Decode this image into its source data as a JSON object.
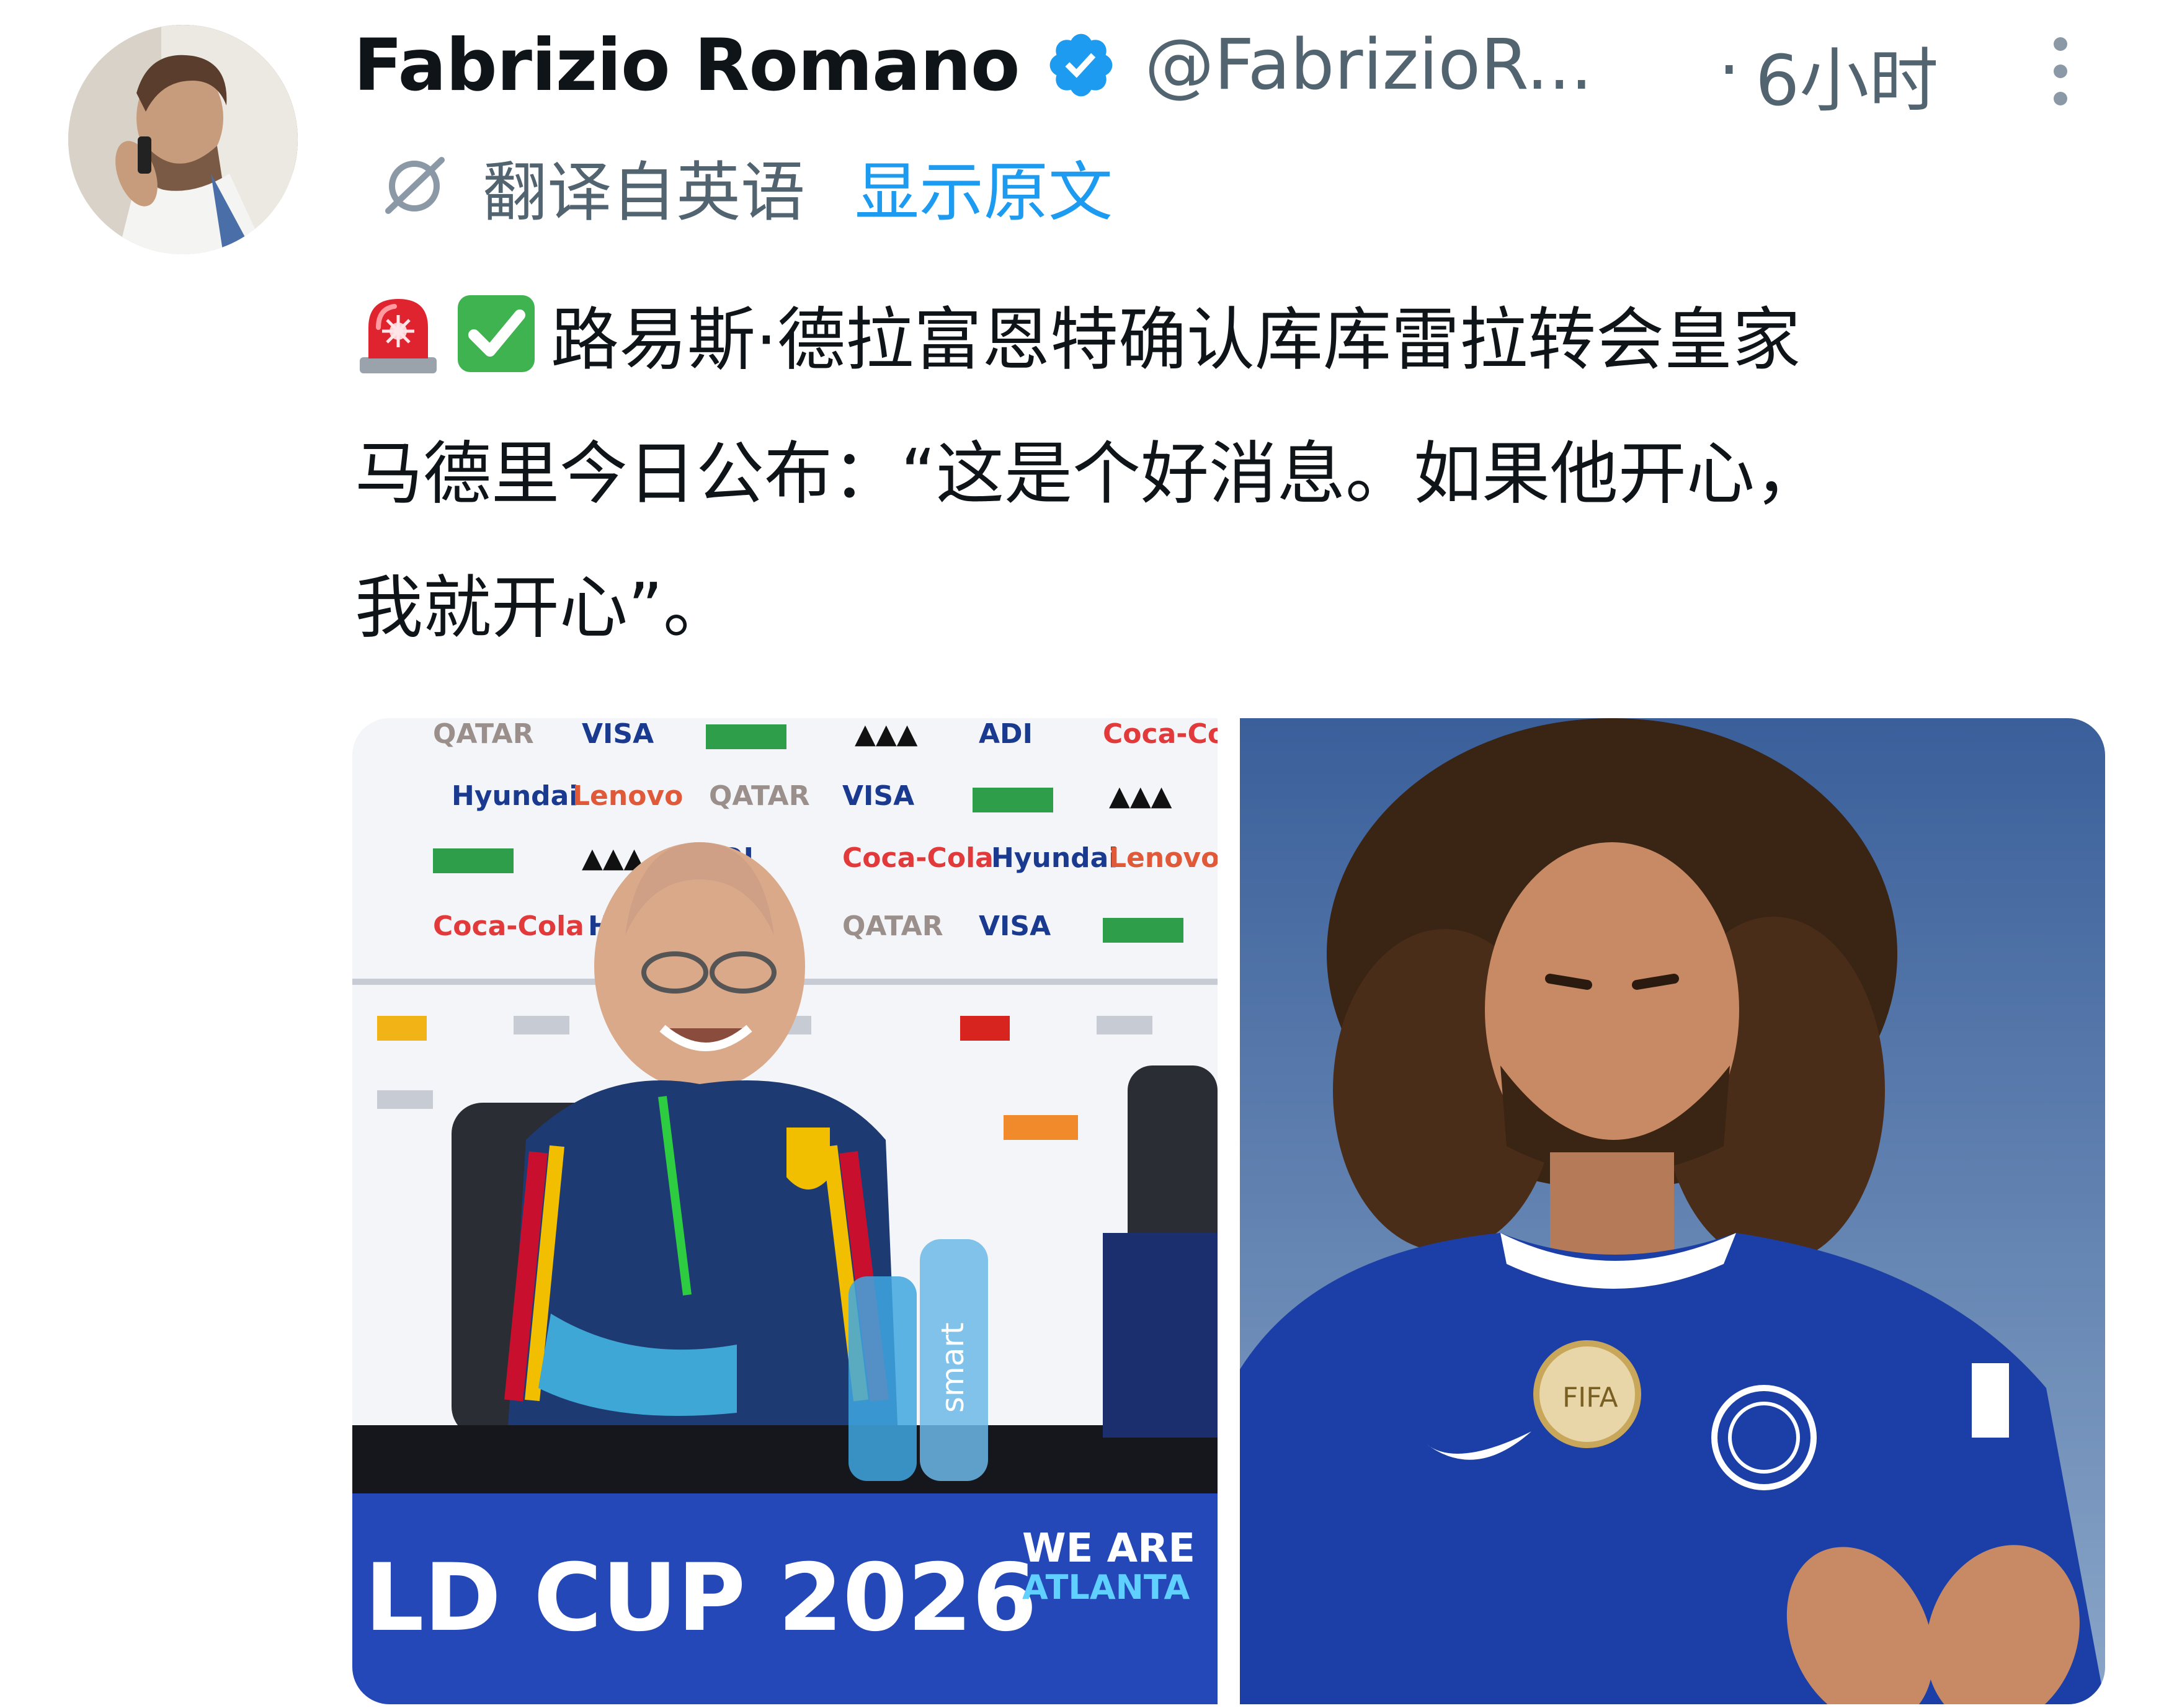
{
  "author": {
    "display_name": "Fabrizio Romano",
    "handle": "@FabrizioR...",
    "verified": true,
    "time_dot": "·",
    "time": "6小时"
  },
  "translation": {
    "label": "翻译自英语",
    "show_original": "显示原文"
  },
  "tweet": {
    "emojis": [
      "police-light-emoji",
      "check-mark-emoji"
    ],
    "line1": "路易斯·德拉富恩特确认库库雷拉转会皇家",
    "line2": "马德里今日公布：“这是个好消息。如果他开心，",
    "line3": "我就开心”。"
  },
  "media": {
    "left_photo": {
      "backdrop_text": "QATAR  VISA  ADI  Lenovo  Coca-Cola",
      "banner_text": "LD CUP 2026",
      "we_are": "WE ARE",
      "city": "ATLANTA",
      "bottle_text": "smart"
    },
    "right_photo": {
      "badge_text": "FIFA"
    }
  },
  "colors": {
    "accent": "#1d9bf0",
    "secondary_text": "#536471",
    "primary_text": "#0f1419",
    "chelsea_blue": "#1b3fa6"
  }
}
